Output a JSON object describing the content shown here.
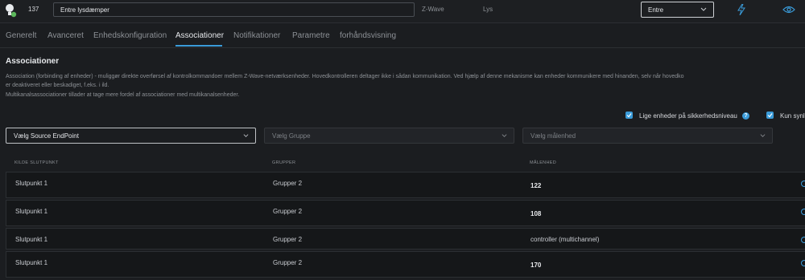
{
  "header": {
    "device_id": "137",
    "device_name": "Entre lysdæmper",
    "protocol": "Z-Wave",
    "category": "Lys",
    "room": "Entre"
  },
  "tabs": [
    {
      "label": "Generelt"
    },
    {
      "label": "Avanceret"
    },
    {
      "label": "Enhedskonfiguration"
    },
    {
      "label": "Associationer",
      "active": true
    },
    {
      "label": "Notifikationer"
    },
    {
      "label": "Parametre"
    },
    {
      "label": "forhåndsvisning"
    }
  ],
  "section": {
    "title": "Associationer",
    "desc_line1": "Association (forbinding af enheder) - muliggør direkte overførsel af kontrolkommandoer mellem Z-Wave-netværksenheder. Hovedkontrolleren deltager ikke i sådan kommunikation. Ved hjælp af denne mekanisme kan enheder kommunikere med hinanden, selv når hovedko",
    "desc_line2": "er deaktiveret eller beskadiget, f.eks. i ild.",
    "desc_line3": "Multikanalsassociationer tillader at tage mere fordel af associationer med multikanalsenheder."
  },
  "options": {
    "same_security_label": "Lige enheder på sikkerhedsniveau",
    "only_sync_label": "Kun synl"
  },
  "filters": {
    "source_endpoint": "Vælg Source EndPoint",
    "group": "Vælg Gruppe",
    "target": "Vælg målenhed"
  },
  "table": {
    "headers": [
      "KILDE SLUTPUNKT",
      "GRUPPER",
      "MÅLENHED"
    ],
    "rows": [
      {
        "source": "Slutpunkt 1",
        "group": "Grupper 2",
        "target": "122"
      },
      {
        "source": "Slutpunkt 1",
        "group": "Grupper 2",
        "target": "108"
      },
      {
        "source": "Slutpunkt 1",
        "group": "Grupper 2",
        "target": "controller (multichannel)"
      },
      {
        "source": "Slutpunkt 1",
        "group": "Grupper 2",
        "target": "170"
      }
    ]
  },
  "colors": {
    "accent": "#3a9bd9",
    "status_green": "#5cb85c",
    "background": "#1b1d20"
  }
}
